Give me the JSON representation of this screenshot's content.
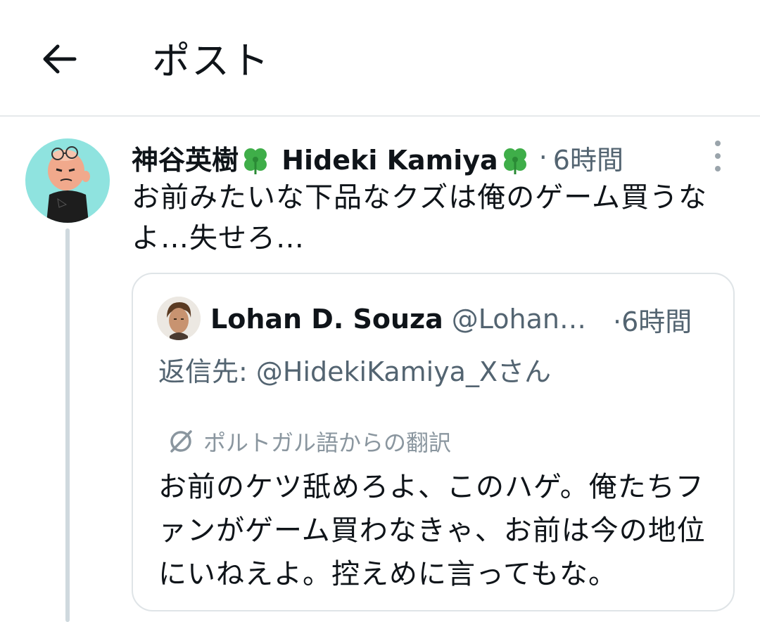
{
  "header": {
    "title": "ポスト",
    "back_icon": "arrow-left-icon"
  },
  "post": {
    "display_name_jp": "神谷英樹",
    "display_name_en": "Hideki Kamiya",
    "emoji": "four-leaf-clover",
    "separator": "·",
    "time": "6時間",
    "text": "お前みたいな下品なクズは俺のゲーム買うなよ…失せろ…",
    "more_icon": "more-vertical-icon"
  },
  "quote": {
    "name": "Lohan D. Souza",
    "handle": "@Lohan…",
    "separator": "·",
    "time": "6時間",
    "reply_to": "返信先: @HidekiKamiya_Xさん",
    "translation_label": "ポルトガル語からの翻訳",
    "translation_icon": "translate-icon",
    "text": "お前のケツ舐めろよ、このハゲ。俺たちファンがゲーム買わなきゃ、お前は今の地位にいねえよ。控えめに言ってもな。"
  },
  "colors": {
    "text_primary": "#0f1419",
    "text_secondary": "#536471",
    "border": "#dfe4e7",
    "avatar_bg": "#8fe3df",
    "thread_line": "#cfd9de"
  }
}
